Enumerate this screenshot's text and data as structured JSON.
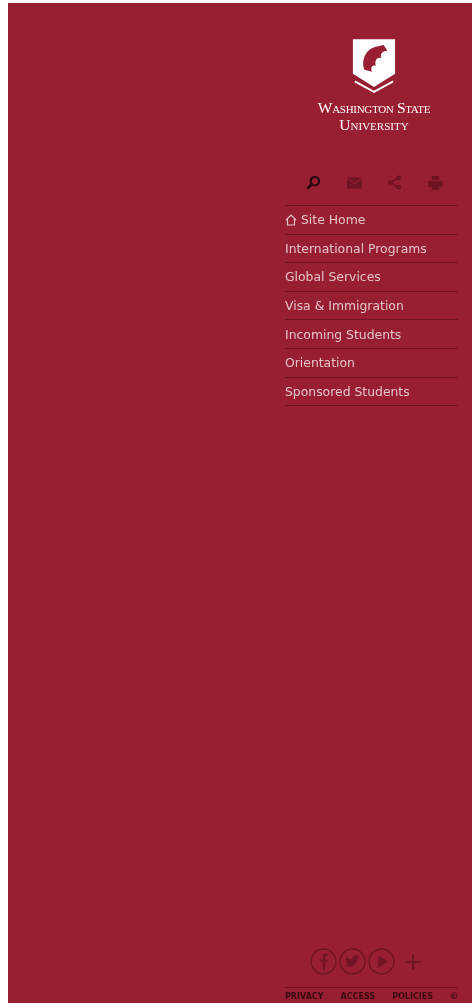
{
  "logo": {
    "line_1": "Washington State",
    "line_2": "University"
  },
  "tools": [
    {
      "kind": "search",
      "selected": true
    },
    {
      "kind": "email",
      "selected": false
    },
    {
      "kind": "share",
      "selected": false
    },
    {
      "kind": "print",
      "selected": false
    }
  ],
  "nav": [
    {
      "label": "Site Home",
      "kind": "home"
    },
    {
      "label": "International Programs",
      "kind": "link"
    },
    {
      "label": "Global Services",
      "kind": "link"
    },
    {
      "label": "Visa & Immigration",
      "kind": "link"
    },
    {
      "label": "Incoming Students",
      "kind": "link"
    },
    {
      "label": "Orientation",
      "kind": "link"
    },
    {
      "label": "Sponsored Students",
      "kind": "link"
    }
  ],
  "social": [
    {
      "kind": "facebook"
    },
    {
      "kind": "twitter"
    },
    {
      "kind": "youtube"
    },
    {
      "kind": "more",
      "label": "+"
    }
  ],
  "footer_links": [
    "PRIVACY",
    "ACCESS",
    "POLICIES",
    "©"
  ]
}
